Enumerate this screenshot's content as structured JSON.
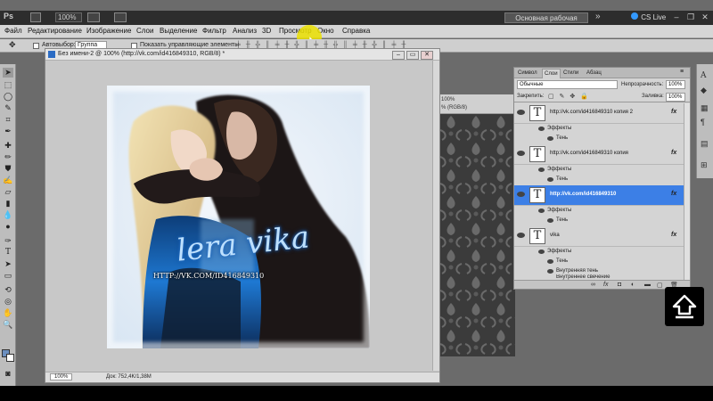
{
  "appbar": {
    "logo": "Ps",
    "zoom": "100%",
    "workspace": "Основная рабочая среда",
    "cs_live": "CS Live",
    "expand_glyph": "»",
    "minimize": "–",
    "restore": "❐",
    "close": "✕"
  },
  "menu": [
    "Файл",
    "Редактирование",
    "Изображение",
    "Слои",
    "Выделение",
    "Фильтр",
    "Анализ",
    "3D",
    "Просмотр",
    "Окно",
    "Справка"
  ],
  "options_bar": {
    "auto_select": "Автовыбор:",
    "group_value": "Группа",
    "show_controls": "Показать управляющие элементы"
  },
  "document": {
    "title": "Без имени-2 @ 100% (http://vk.com/id416849310, RGB/8) *",
    "overlay_text": "lera vika",
    "url_text": "HTTP://VK.COM/ID416849310",
    "zoom": "100%",
    "doc_info": "Док: 752,4K/1,38M"
  },
  "background_doc": {
    "title_zoom": "100%",
    "title_mode": "% (RGB/8)"
  },
  "layers_panel": {
    "tabs": [
      "Символ",
      "Слои",
      "Стили",
      "Абзац"
    ],
    "blend_mode": "Обычные",
    "opacity_label": "Непрозрачность:",
    "opacity": "100%",
    "lock_label": "Закрепить:",
    "fill_label": "Заливка:",
    "fill": "100%",
    "layers": [
      {
        "name": "http://vk.com/id416849310 копия 2",
        "fx": "fx",
        "effects_label": "Эффекты",
        "effects": [
          "Тень"
        ]
      },
      {
        "name": "http://vk.com/id416849310 копия",
        "fx": "fx",
        "effects_label": "Эффекты",
        "effects": [
          "Тень"
        ]
      },
      {
        "name": "http://vk.com/id416849310",
        "fx": "fx",
        "effects_label": "Эффекты",
        "effects": [
          "Тень"
        ]
      },
      {
        "name": "vika",
        "fx": "fx",
        "effects_label": "Эффекты",
        "effects": [
          "Тень",
          "Внутренняя тень",
          "Внутреннее свечение"
        ]
      }
    ]
  },
  "colors": {
    "selection_blue": "#3c7fe6",
    "highlight_yellow": "#ebe100",
    "jacket_blue": "#1e78d2"
  }
}
